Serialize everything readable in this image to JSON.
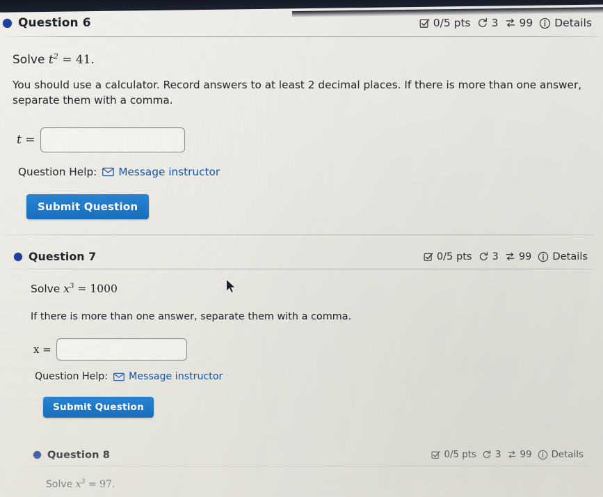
{
  "page": {
    "background_color": "#eceae4",
    "accent_blue": "#1f79c9",
    "link_blue": "#1556ab",
    "dot_color": "#1f3f9e"
  },
  "meta_labels": {
    "points": "0/5 pts",
    "attempts": "3",
    "versions": "99",
    "details": "Details",
    "checkbox_icon": "checkbox-check-icon",
    "retry_icon": "counterclockwise-arrow-icon",
    "shuffle_icon": "swap-arrows-icon",
    "info_icon": "info-circle-icon"
  },
  "common": {
    "help_label": "Question Help:",
    "message_instructor": "Message instructor",
    "submit_label": "Submit Question",
    "envelope_icon": "envelope-icon"
  },
  "questions": [
    {
      "id": "q6",
      "title": "Question 6",
      "prompt_prefix": "Solve ",
      "prompt_var": "t",
      "prompt_exp": "2",
      "prompt_eq": " = ",
      "prompt_value": "41",
      "prompt_suffix": ".",
      "paragraph": "You should use a calculator. Record answers to at least 2 decimal places. If there is more than one answer, separate them with a comma.",
      "answer_var": "t",
      "answer_equals": "=",
      "answer_value": "",
      "answer_placeholder": ""
    },
    {
      "id": "q7",
      "title": "Question 7",
      "prompt_prefix": "Solve ",
      "prompt_var": "x",
      "prompt_exp": "3",
      "prompt_eq": " = ",
      "prompt_value": "1000",
      "prompt_suffix": "",
      "paragraph": "If there is more than one answer, separate them with a comma.",
      "answer_var": "x",
      "answer_equals": "=",
      "answer_value": "",
      "answer_placeholder": ""
    },
    {
      "id": "q8",
      "title": "Question 8",
      "prompt_prefix": "Solve ",
      "prompt_var": "x",
      "prompt_exp": "3",
      "prompt_eq": " = ",
      "prompt_value": "97",
      "prompt_suffix": "."
    }
  ]
}
